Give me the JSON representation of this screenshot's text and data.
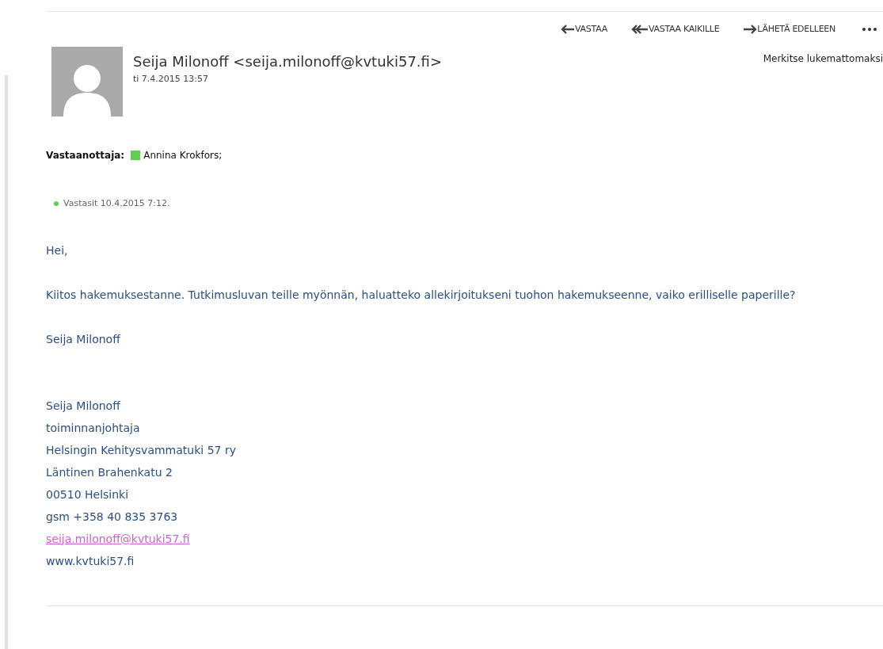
{
  "toolbar": {
    "actions": [
      {
        "kind": "reply",
        "label": "VASTAA"
      },
      {
        "kind": "reply_all",
        "label": "VASTAA KAIKILLE"
      },
      {
        "kind": "forward",
        "label": "LÄHETÄ EDELLEEN"
      },
      {
        "kind": "more"
      }
    ]
  },
  "message": {
    "sender": "Seija Milonoff <seija.milonoff@kvtuki57.fi>",
    "date": "ti 7.4.2015 13:57",
    "mark_unread": "Merkitse lukemattomaksi",
    "recipients_label": "Vastaanottaja:",
    "recipients": [
      {
        "name": "Annina Krokfors;",
        "color": "#5fcf4f"
      }
    ],
    "status": {
      "text": "Vastasit 10.4.2015 7:12.",
      "color": "#5fcf4f"
    },
    "body": [
      "Hei,",
      "Kiitos hakemuksestanne. Tutkimusluvan teille myönnän, haluatteko allekirjoitukseni tuohon hakemukseenne, vaiko erilliselle paperille?",
      "Seija Milonoff"
    ],
    "signature": [
      {
        "kind": "text",
        "text": "Seija Milonoff"
      },
      {
        "kind": "text",
        "text": "toiminnanjohtaja"
      },
      {
        "kind": "text",
        "text": "Helsingin Kehitysvammatuki 57 ry"
      },
      {
        "kind": "text",
        "text": "Läntinen Brahenkatu 2"
      },
      {
        "kind": "text",
        "text": "00510 Helsinki"
      },
      {
        "kind": "text",
        "text": "gsm +358 40 835 3763"
      },
      {
        "kind": "link",
        "text": "seija.milonoff@kvtuki57.fi"
      },
      {
        "kind": "text",
        "text": "www.kvtuki57.fi"
      }
    ]
  }
}
